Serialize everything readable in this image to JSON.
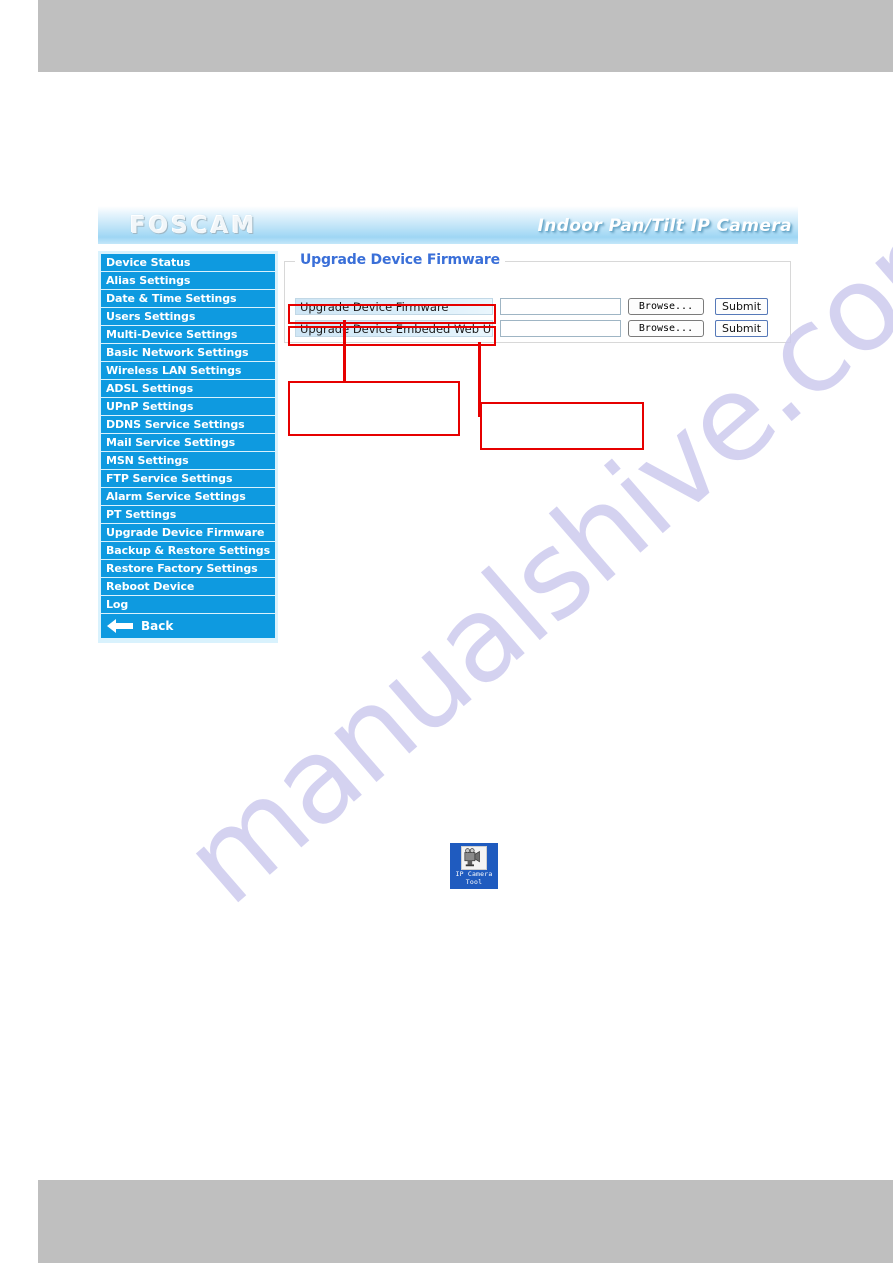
{
  "page": {
    "background_color": "#ffffff",
    "band_color": "#bfbfbf"
  },
  "watermark": {
    "text": "manualshive.com",
    "color": "#cdcbee"
  },
  "camera_ui": {
    "header": {
      "brand": "FOSCAM",
      "product_title": "Indoor Pan/Tilt IP Camera",
      "accent_color": "#9ed6f4"
    },
    "sidebar": {
      "accent_color": "#0e9ae0",
      "items": [
        {
          "label": "Device Status"
        },
        {
          "label": "Alias Settings"
        },
        {
          "label": "Date & Time Settings"
        },
        {
          "label": "Users Settings"
        },
        {
          "label": "Multi-Device Settings"
        },
        {
          "label": "Basic Network Settings"
        },
        {
          "label": "Wireless LAN Settings"
        },
        {
          "label": "ADSL Settings"
        },
        {
          "label": "UPnP Settings"
        },
        {
          "label": "DDNS Service Settings"
        },
        {
          "label": "Mail Service Settings"
        },
        {
          "label": "MSN Settings"
        },
        {
          "label": "FTP Service Settings"
        },
        {
          "label": "Alarm Service Settings"
        },
        {
          "label": "PT Settings"
        },
        {
          "label": "Upgrade Device Firmware"
        },
        {
          "label": "Backup & Restore Settings"
        },
        {
          "label": "Restore Factory Settings"
        },
        {
          "label": "Reboot Device"
        },
        {
          "label": "Log"
        }
      ],
      "back_label": "Back",
      "back_icon": "arrow-left-icon"
    },
    "content": {
      "legend": "Upgrade Device Firmware",
      "rows": [
        {
          "label": "Upgrade Device Firmware",
          "input_value": "",
          "input_placeholder": "",
          "browse_label": "Browse...",
          "submit_label": "Submit"
        },
        {
          "label": "Upgrade Device Embeded Web UI",
          "input_value": "",
          "input_placeholder": "",
          "browse_label": "Browse...",
          "submit_label": "Submit"
        }
      ]
    }
  },
  "annotations": {
    "color": "#e60000",
    "callouts": [
      {
        "text": ""
      },
      {
        "text": ""
      }
    ]
  },
  "desktop_icon": {
    "label_line_1": "IP Camera",
    "label_line_2": "Tool",
    "icon": "ip-camera-tool-icon",
    "selection_color": "#1f5bbf"
  }
}
